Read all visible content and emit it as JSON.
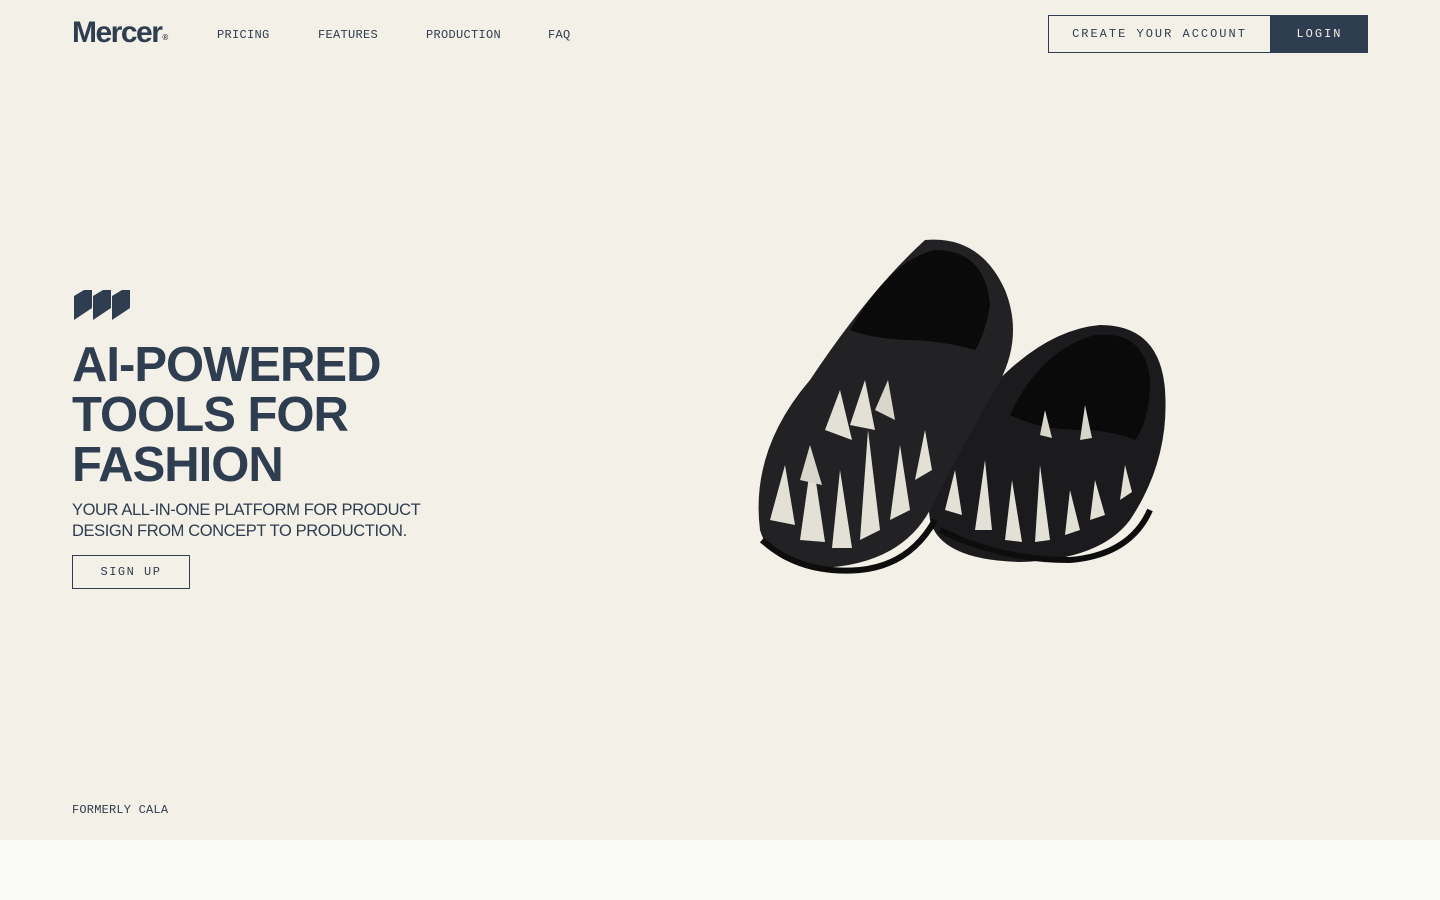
{
  "header": {
    "logo": "Mercer",
    "logo_mark": "®",
    "nav": [
      {
        "label": "PRICING"
      },
      {
        "label": "FEATURES"
      },
      {
        "label": "PRODUCTION"
      },
      {
        "label": "FAQ"
      }
    ],
    "create_account_label": "CREATE YOUR ACCOUNT",
    "login_label": "LOGIN"
  },
  "hero": {
    "title_lines": [
      "AI-POWERED",
      "TOOLS FOR",
      "FASHION"
    ],
    "subtitle": "YOUR ALL-IN-ONE PLATFORM FOR PRODUCT DESIGN FROM CONCEPT TO PRODUCTION.",
    "signup_label": "SIGN UP",
    "image_icon": "loafer-shoes-image"
  },
  "footer_note": "FORMERLY CALA",
  "colors": {
    "background": "#f3f0e8",
    "brand": "#2e3d4f",
    "lower_section": "#f9f9f7"
  }
}
